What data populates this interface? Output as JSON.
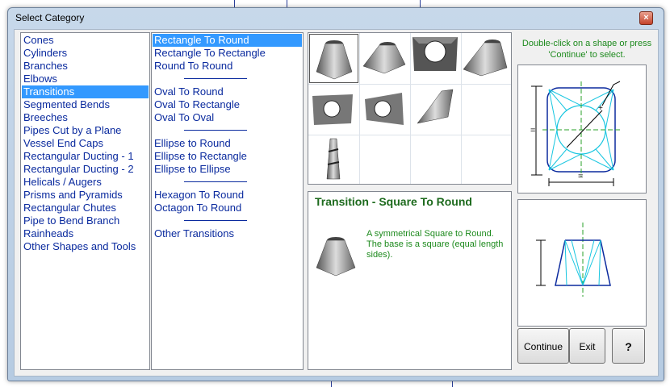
{
  "window": {
    "title": "Select Category",
    "close_glyph": "×"
  },
  "categories": {
    "items": [
      "Cones",
      "Cylinders",
      "Branches",
      "Elbows",
      "Transitions",
      "Segmented Bends",
      "Breeches",
      "Pipes Cut by a Plane",
      "Vessel End Caps",
      "Rectangular Ducting - 1",
      "Rectangular Ducting - 2",
      "Helicals / Augers",
      "Prisms and Pyramids",
      "Rectangular Chutes",
      "Pipe to Bend Branch",
      "Rainheads",
      "Other Shapes and Tools"
    ],
    "selected": "Transitions"
  },
  "subcategories": {
    "items": [
      "Rectangle To Round",
      "Rectangle To Rectangle",
      "Round To Round",
      "Oval To Round",
      "Oval To Rectangle",
      "Oval To Oval",
      "Ellipse to Round",
      "Ellipse to Rectangle",
      "Ellipse to Ellipse",
      "Hexagon To Round",
      "Octagon To Round",
      "Other Transitions"
    ],
    "selected": "Rectangle To Round"
  },
  "hint": "Double-click on a shape or press 'Continue' to select.",
  "description": {
    "title": "Transition - Square To Round",
    "text": "A symmetrical Square to Round. The base is a square (equal length sides)."
  },
  "buttons": {
    "continue": "Continue",
    "exit": "Exit",
    "help_icon": "?"
  },
  "icons": [
    "close-icon",
    "shape-thumbnail-icon",
    "help-icon"
  ],
  "colors": {
    "selection": "#3399ff",
    "list_text": "#0a2a9e",
    "hint_text": "#1d8a1d",
    "diagram_cyan": "#18c6e0",
    "diagram_green": "#2aa02a"
  }
}
